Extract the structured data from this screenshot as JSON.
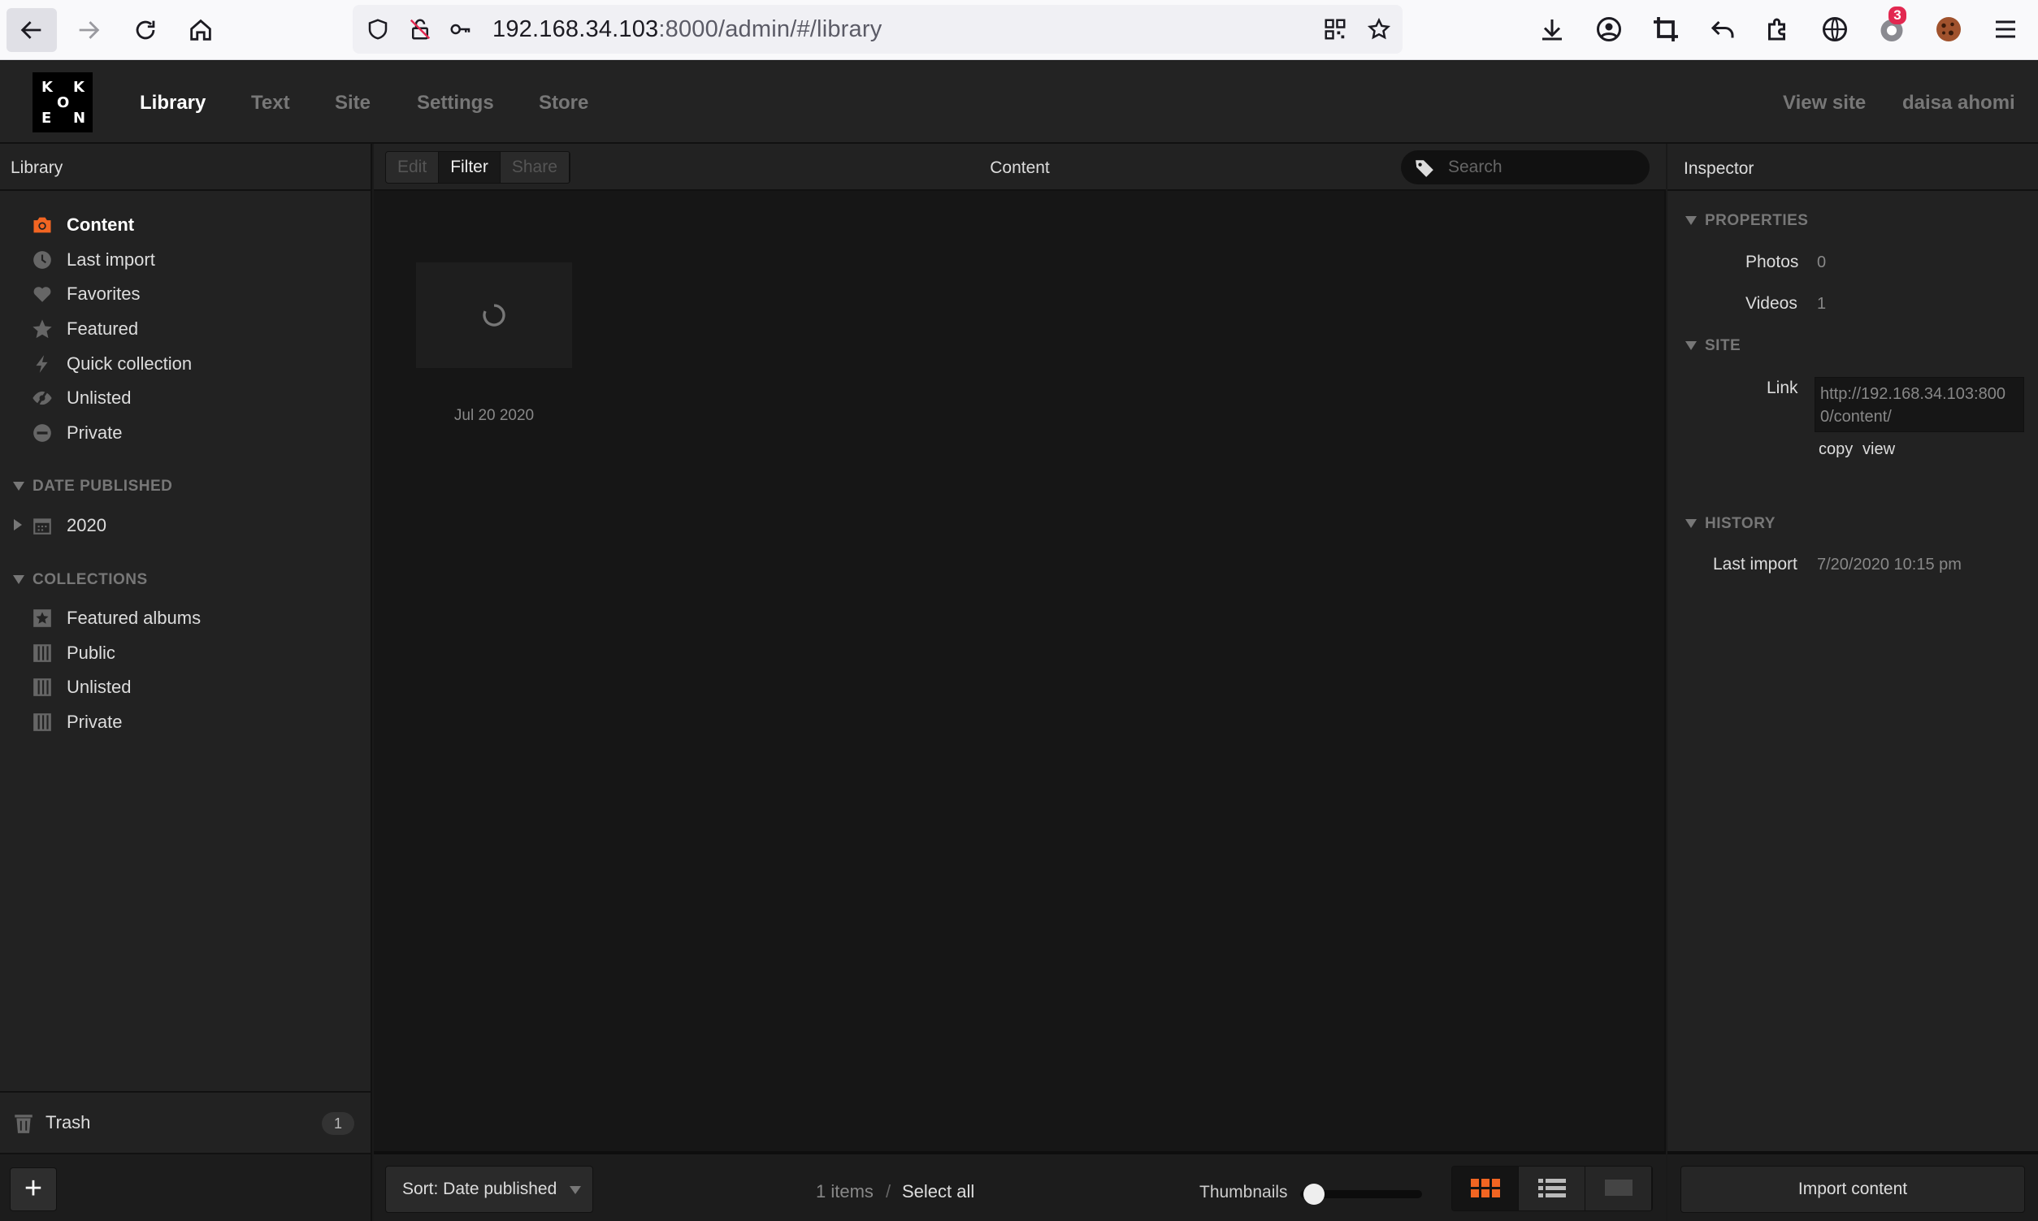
{
  "browser": {
    "url_host": "192.168.34.103",
    "url_rest": ":8000/admin/#/library",
    "notification_count": "3"
  },
  "header": {
    "logo_letters": [
      "K",
      "K",
      "O",
      "E",
      "N"
    ],
    "nav": [
      {
        "label": "Library",
        "active": true
      },
      {
        "label": "Text",
        "active": false
      },
      {
        "label": "Site",
        "active": false
      },
      {
        "label": "Settings",
        "active": false
      },
      {
        "label": "Store",
        "active": false
      }
    ],
    "view_site": "View site",
    "user": "daisa ahomi"
  },
  "sidebar": {
    "title": "Library",
    "items": [
      {
        "label": "Content",
        "icon": "camera-icon",
        "active": true
      },
      {
        "label": "Last import",
        "icon": "clock-icon"
      },
      {
        "label": "Favorites",
        "icon": "heart-icon"
      },
      {
        "label": "Featured",
        "icon": "star-icon"
      },
      {
        "label": "Quick collection",
        "icon": "lightning-icon"
      },
      {
        "label": "Unlisted",
        "icon": "eye-slash-icon"
      },
      {
        "label": "Private",
        "icon": "minus-circle-icon"
      }
    ],
    "date_section": "DATE PUBLISHED",
    "date_items": [
      {
        "label": "2020",
        "icon": "calendar-icon"
      }
    ],
    "collections_section": "COLLECTIONS",
    "collections": [
      {
        "label": "Featured albums",
        "icon": "featured-album-icon"
      },
      {
        "label": "Public",
        "icon": "album-icon"
      },
      {
        "label": "Unlisted",
        "icon": "album-icon"
      },
      {
        "label": "Private",
        "icon": "album-icon"
      }
    ],
    "trash_label": "Trash",
    "trash_count": "1"
  },
  "toolbar": {
    "edit": "Edit",
    "filter": "Filter",
    "share": "Share",
    "title": "Content",
    "search_placeholder": "Search"
  },
  "content": {
    "items": [
      {
        "date": "Jul 20 2020"
      }
    ]
  },
  "footer": {
    "sort_label": "Sort: Date published",
    "items_count": "1 items",
    "separator": "/",
    "select_all": "Select all",
    "thumbnails_label": "Thumbnails",
    "import_button": "Import content"
  },
  "inspector": {
    "title": "Inspector",
    "properties_section": "PROPERTIES",
    "photos_label": "Photos",
    "photos_value": "0",
    "videos_label": "Videos",
    "videos_value": "1",
    "site_section": "SITE",
    "link_label": "Link",
    "link_value": "http://192.168.34.103:8000/content/",
    "copy_label": "copy",
    "view_label": "view",
    "history_section": "HISTORY",
    "last_import_label": "Last import",
    "last_import_value": "7/20/2020 10:15 pm"
  },
  "colors": {
    "accent": "#f26522",
    "chrome_bg": "#f9f9fb",
    "app_bg": "#1a1a1a"
  }
}
